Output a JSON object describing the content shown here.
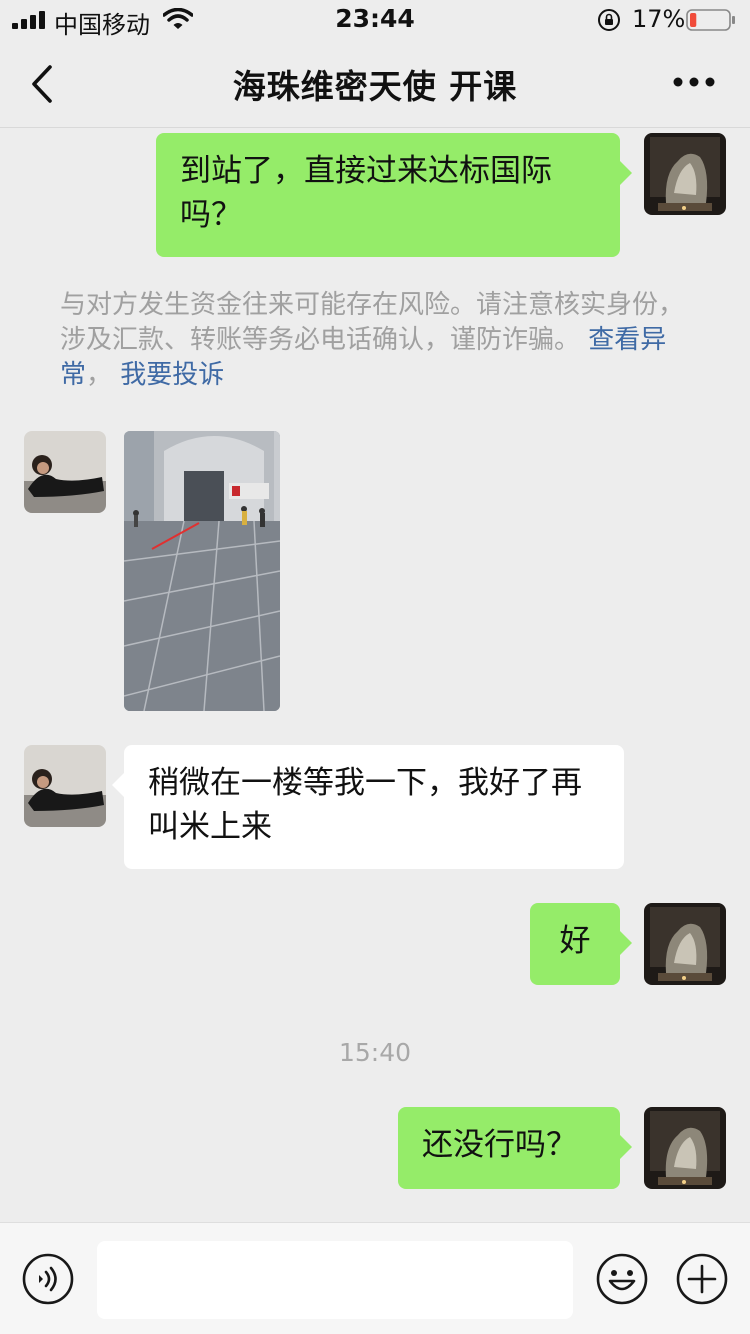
{
  "status_bar": {
    "carrier": "中国移动",
    "time": "23:44",
    "battery": "17%",
    "battery_level": 0.17,
    "icons": [
      "signal-icon",
      "wifi-icon",
      "orientation-lock-icon",
      "battery-icon"
    ]
  },
  "nav": {
    "title": "海珠维密天使 开课",
    "back_icon": "back-chevron-icon",
    "more_icon": "more-dots-icon"
  },
  "messages": [
    {
      "from": "me",
      "text": "到站了，直接过来达标国际吗？"
    },
    {
      "from": "other",
      "type": "image"
    },
    {
      "from": "other",
      "text": "稍微在一楼等我一下，我好了再叫米上来"
    },
    {
      "from": "me",
      "text": "好"
    },
    {
      "from": "me",
      "text": "还没行吗？"
    }
  ],
  "warning": {
    "text": "与对方发生资金往来可能存在风险。请注意核实身份，涉及汇款、转账等务必电话确认，谨防诈骗。",
    "link1": "查看异常",
    "separator": "，",
    "link2": "我要投诉"
  },
  "timestamp": "15:40",
  "input_bar": {
    "text_value": "",
    "icons": [
      "voice-icon",
      "emoji-icon",
      "plus-icon"
    ]
  },
  "colors": {
    "background": "#ededed",
    "my_bubble": "#95ec69",
    "other_bubble": "#ffffff",
    "link": "#3f6aa5",
    "battery_low": "#f04b3a"
  }
}
